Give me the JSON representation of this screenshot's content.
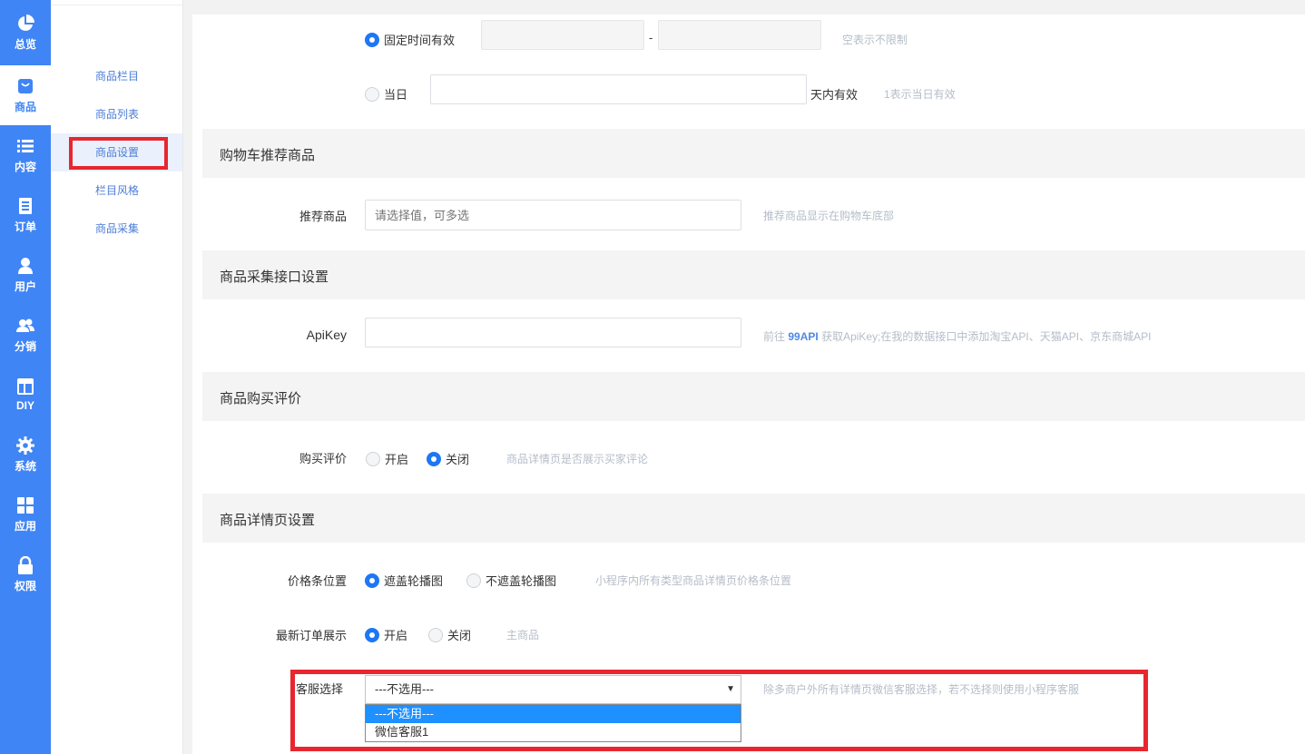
{
  "nav": {
    "items": [
      {
        "label": "总览",
        "icon": "pie-chart-icon"
      },
      {
        "label": "商品",
        "icon": "shopping-bag-icon"
      },
      {
        "label": "内容",
        "icon": "list-icon"
      },
      {
        "label": "订单",
        "icon": "document-icon"
      },
      {
        "label": "用户",
        "icon": "user-icon"
      },
      {
        "label": "分销",
        "icon": "users-icon"
      },
      {
        "label": "DIY",
        "icon": "layout-icon"
      },
      {
        "label": "系统",
        "icon": "gear-icon"
      },
      {
        "label": "应用",
        "icon": "grid-icon"
      },
      {
        "label": "权限",
        "icon": "lock-icon"
      }
    ],
    "active_color": "#4085f5"
  },
  "subnav": {
    "items": [
      {
        "label": "商品栏目"
      },
      {
        "label": "商品列表"
      },
      {
        "label": "商品设置"
      },
      {
        "label": "栏目风格"
      },
      {
        "label": "商品采集"
      }
    ]
  },
  "validity": {
    "fixed_label": "固定时间有效",
    "dash": "-",
    "fixed_hint": "空表示不限制",
    "day_label": "当日",
    "day_suffix": "天内有效",
    "day_hint": "1表示当日有效"
  },
  "cart_section": {
    "title": "购物车推荐商品",
    "field_label": "推荐商品",
    "placeholder": "请选择值，可多选",
    "hint": "推荐商品显示在购物车底部"
  },
  "api_section": {
    "title": "商品采集接口设置",
    "field_label": "ApiKey",
    "hint_prefix": "前往",
    "hint_link": "99API",
    "hint_suffix": "获取ApiKey;在我的数据接口中添加淘宝API、天猫API、京东商城API"
  },
  "review_section": {
    "title": "商品购买评价",
    "field_label": "购买评价",
    "opt_on": "开启",
    "opt_off": "关闭",
    "hint": "商品详情页是否展示买家评论"
  },
  "detail_section": {
    "title": "商品详情页设置",
    "price_label": "价格条位置",
    "price_opt1": "遮盖轮播图",
    "price_opt2": "不遮盖轮播图",
    "price_hint": "小程序内所有类型商品详情页价格条位置",
    "order_label": "最新订单展示",
    "order_on": "开启",
    "order_off": "关闭",
    "order_hint": "主商品",
    "service_label": "客服选择",
    "service_value": "---不选用---",
    "service_options": [
      "---不选用---",
      "微信客服1"
    ],
    "service_hint": "除多商户外所有详情页微信客服选择，若不选择则使用小程序客服"
  }
}
